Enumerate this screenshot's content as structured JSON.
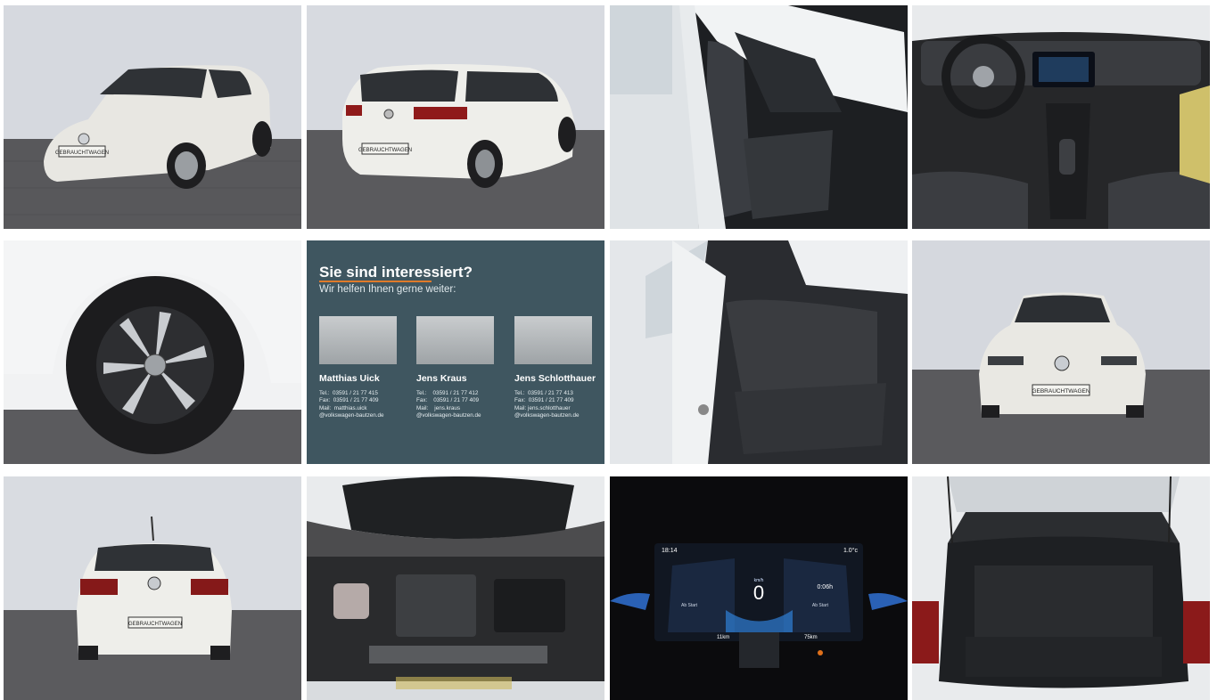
{
  "gallery": {
    "photos": [
      {
        "name": "front-three-quarter-photo",
        "plate": "GEBRAUCHTWAGEN"
      },
      {
        "name": "rear-three-quarter-photo",
        "plate": "GEBRAUCHTWAGEN"
      },
      {
        "name": "front-seats-interior-photo"
      },
      {
        "name": "dashboard-cockpit-photo"
      },
      {
        "name": "alloy-wheel-photo"
      },
      {
        "name": "rear-seats-photo"
      },
      {
        "name": "front-view-photo",
        "plate": "GEBRAUCHTWAGEN"
      },
      {
        "name": "rear-view-photo",
        "plate": "GEBRAUCHTWAGEN"
      },
      {
        "name": "engine-bay-photo"
      },
      {
        "name": "digital-cockpit-photo"
      },
      {
        "name": "trunk-open-photo"
      }
    ]
  },
  "contact": {
    "heading": "Sie sind interessiert?",
    "subheading": "Wir helfen Ihnen gerne weiter:",
    "people": [
      {
        "name": "Matthias Uick",
        "info": "Tel.:  03591 / 21 77 415\nFax:  03591 / 21 77 409\nMail:  matthias.uick\n@volkswagen-bautzen.de"
      },
      {
        "name": "Jens Kraus",
        "info": "Tel.:    03591 / 21 77 412\nFax:    03591 / 21 77 409\nMail:    jens.kraus\n@volkswagen-bautzen.de"
      },
      {
        "name": "Jens Schlotthauer",
        "info": "Tel.:  03591 / 21 77 413\nFax:  03591 / 21 77 409\nMail: jens.schlotthauer\n@volkswagen-bautzen.de"
      }
    ]
  },
  "cockpit": {
    "time": "18:14",
    "temp": "1.0°c",
    "speed": "0",
    "speed_unit": "km/h",
    "trip_time": "0:06h",
    "trip_label": "Ab Start",
    "consumption_label": "Ab Start",
    "range_left": "11km",
    "range_right": "75km"
  },
  "colors": {
    "contact_bg": "#3f5660",
    "accent": "#e07a2a",
    "car_body": "#e9e9e4",
    "wall": "#d5d8de",
    "pavement": "#57575a"
  }
}
